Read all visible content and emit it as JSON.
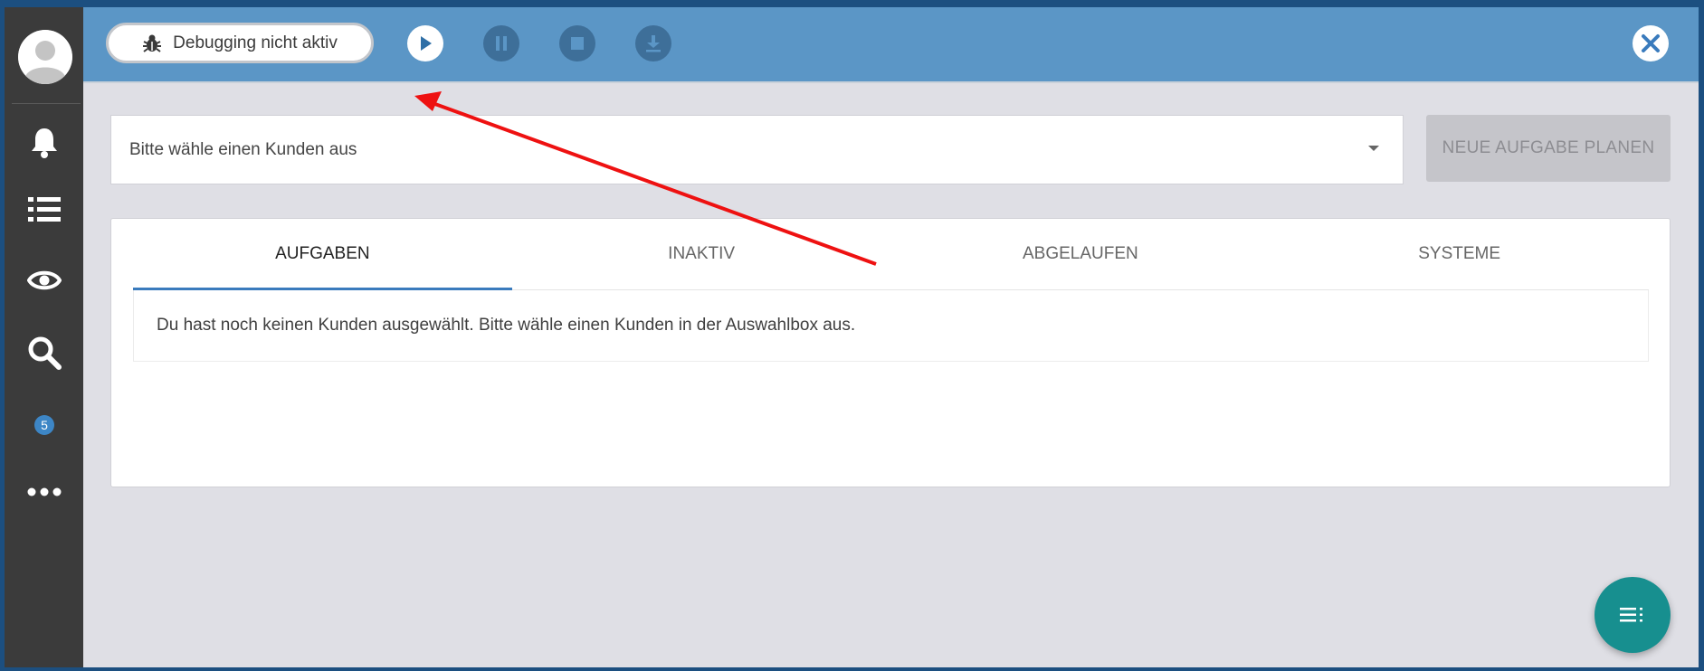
{
  "toolbar": {
    "debug_label": "Debugging nicht aktiv"
  },
  "sidebar": {
    "badge_count": "5",
    "icons": [
      "bell-icon",
      "list-icon",
      "eye-icon",
      "search-icon",
      "more-icon"
    ]
  },
  "customer_select": {
    "placeholder": "Bitte wähle einen Kunden aus"
  },
  "actions": {
    "new_task_label": "NEUE AUFGABE PLANEN"
  },
  "tabs": [
    {
      "label": "AUFGABEN",
      "active": true
    },
    {
      "label": "INAKTIV",
      "active": false
    },
    {
      "label": "ABGELAUFEN",
      "active": false
    },
    {
      "label": "SYSTEME",
      "active": false
    }
  ],
  "tab_content": {
    "message": "Du hast noch keinen Kunden ausgewählt. Bitte wähle einen Kunden in der Auswahlbox aus."
  },
  "colors": {
    "topbar": "#5b96c6",
    "sidebar": "#3b3b3b",
    "fab": "#178f8f",
    "accent": "#3a7bbd",
    "annotation_arrow": "#ee1111"
  }
}
